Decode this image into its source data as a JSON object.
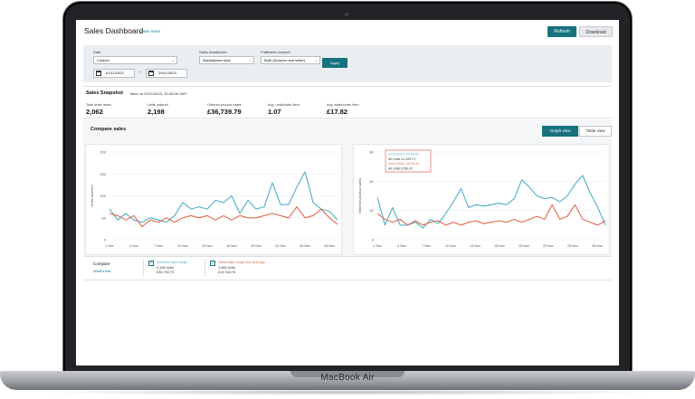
{
  "header": {
    "title": "Sales Dashboard",
    "learn_more": "Learn more",
    "refresh": "Refresh",
    "download": "Download"
  },
  "filters": {
    "date": {
      "label": "Date",
      "value": "Custom",
      "from": "01/11/2023",
      "to": "29/11/2023"
    },
    "breakdown": {
      "label": "Sales breakdown",
      "value": "Marketplace total"
    },
    "channel": {
      "label": "Fulfilment channel",
      "value": "Both (Amazon and seller)"
    },
    "apply": "Apply"
  },
  "snapshot": {
    "title": "Sales Snapshot",
    "taken": "Taken at 29/11/2023, 15:28:08 GMT",
    "metrics": [
      {
        "label": "Total order items",
        "value": "2,062"
      },
      {
        "label": "Units ordered",
        "value": "2,198"
      },
      {
        "label": "Ordered product sales",
        "value": "£36,739.79"
      },
      {
        "label": "Avg. units/order item",
        "value": "1.07"
      },
      {
        "label": "Avg. sales/order item",
        "value": "£17.82"
      }
    ]
  },
  "compare": {
    "title": "Compare sales",
    "graph_view": "Graph view",
    "table_view": "Table view"
  },
  "colors": {
    "selected": "#4fb0c6",
    "last_year": "#e0694e",
    "accent": "#17727f"
  },
  "tooltip": {
    "line1": "01/11/2023, 00:00:00",
    "line2": "All Units 21,429.71",
    "line3": "01/11/2022, 00:00:00",
    "line4": "All Units £790.47"
  },
  "chart_data": [
    {
      "type": "line",
      "ylabel": "Units ordered",
      "ylim": [
        0,
        200
      ],
      "yticks": [
        "200",
        "150",
        "100",
        "50",
        "0"
      ],
      "x": [
        "1 Nov",
        "2",
        "3",
        "4 Nov",
        "5",
        "6",
        "7 Nov",
        "8",
        "9",
        "10 Nov",
        "11",
        "12",
        "13 Nov",
        "14",
        "15",
        "16 Nov",
        "17",
        "18",
        "19 Nov",
        "20",
        "21",
        "22 Nov",
        "23",
        "24",
        "25 Nov",
        "26",
        "27",
        "28 Nov",
        "29"
      ],
      "xticks": [
        "1 Nov",
        "4 Nov",
        "7 Nov",
        "10 Nov",
        "13 Nov",
        "16 Nov",
        "19 Nov",
        "22 Nov",
        "25 Nov",
        "28 Nov"
      ],
      "series": [
        {
          "name": "Selected date range",
          "values": [
            70,
            45,
            60,
            45,
            40,
            50,
            45,
            40,
            55,
            85,
            70,
            75,
            70,
            90,
            85,
            100,
            60,
            90,
            70,
            75,
            130,
            80,
            80,
            120,
            155,
            85,
            70,
            65,
            45
          ]
        },
        {
          "name": "Same date range one year ago",
          "values": [
            60,
            55,
            45,
            55,
            30,
            45,
            40,
            50,
            40,
            50,
            55,
            50,
            55,
            45,
            55,
            45,
            55,
            50,
            50,
            55,
            60,
            55,
            50,
            75,
            50,
            55,
            70,
            50,
            35
          ]
        }
      ]
    },
    {
      "type": "line",
      "ylabel": "Ordered product sales",
      "ylim": [
        0,
        3000
      ],
      "yticks": [
        "3K",
        "2K",
        "1K",
        "0"
      ],
      "x": [
        "1 Nov",
        "2",
        "3",
        "4 Nov",
        "5",
        "6",
        "7 Nov",
        "8",
        "9",
        "10 Nov",
        "11",
        "12",
        "13 Nov",
        "14",
        "15",
        "16 Nov",
        "17",
        "18",
        "19 Nov",
        "20",
        "21",
        "22 Nov",
        "23",
        "24",
        "25 Nov",
        "26",
        "27",
        "28 Nov",
        "29"
      ],
      "xticks": [
        "1 Nov",
        "4 Nov",
        "7 Nov",
        "10 Nov",
        "13 Nov",
        "16 Nov",
        "19 Nov",
        "22 Nov",
        "25 Nov",
        "28 Nov"
      ],
      "series": [
        {
          "name": "Selected date range",
          "values": [
            1450,
            500,
            1100,
            500,
            500,
            600,
            400,
            700,
            550,
            900,
            1300,
            1750,
            1100,
            1200,
            1150,
            1200,
            1250,
            1200,
            1400,
            2050,
            1800,
            1500,
            1400,
            1450,
            1300,
            1500,
            1900,
            2200,
            1600,
            1100,
            500
          ]
        },
        {
          "name": "Same date range one year ago",
          "values": [
            900,
            700,
            600,
            700,
            500,
            650,
            500,
            600,
            650,
            500,
            600,
            500,
            600,
            650,
            550,
            600,
            650,
            600,
            700,
            600,
            700,
            800,
            700,
            1200,
            700,
            800,
            1200,
            700,
            600,
            500,
            650
          ]
        }
      ]
    }
  ],
  "legend": {
    "title": "Compare",
    "whats_this": "What's this",
    "selected": {
      "name": "Selected date range",
      "units": "2,198 Units",
      "sales": "£36,739.79"
    },
    "last_year": {
      "name": "Same date range one year ago",
      "units": "1,464 Units",
      "sales": "£10,748.76"
    }
  },
  "device": {
    "model": "MacBook Air"
  }
}
